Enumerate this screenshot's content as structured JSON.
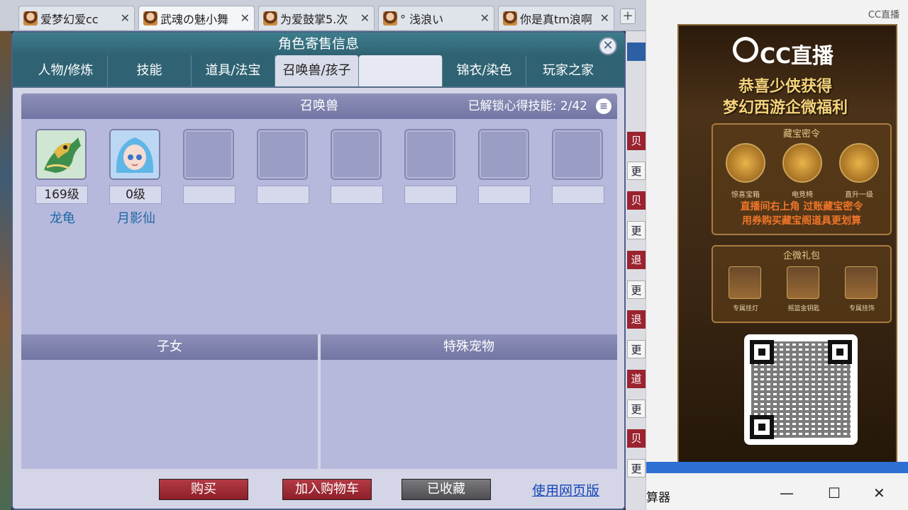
{
  "browser": {
    "tabs": [
      {
        "title": "爱梦幻爱cc",
        "active": false
      },
      {
        "title": "武魂の魅小舞",
        "active": true
      },
      {
        "title": "为爱鼓掌5.次",
        "active": false
      },
      {
        "title": "°  浅浪い",
        "active": false
      },
      {
        "title": "你是真tm浪啊",
        "active": false
      }
    ],
    "new_tab_label": "+",
    "close_glyph": "✕"
  },
  "panel": {
    "title": "角色寄售信息",
    "close_glyph": "✕",
    "tabs": [
      "人物/修炼",
      "技能",
      "道具/法宝",
      "召唤兽/孩子",
      "",
      "锦衣/染色",
      "玩家之家"
    ],
    "active_tab_index": 3
  },
  "pets_section": {
    "title": "召唤兽",
    "skill_label": "已解锁心得技能:",
    "skill_value": "2/42",
    "pets": [
      {
        "level": "169级",
        "name": "龙龟"
      },
      {
        "level": "0级",
        "name": "月影仙"
      }
    ],
    "empty_slots": 6
  },
  "children_section": {
    "title": "子女"
  },
  "special_pets_section": {
    "title": "特殊宠物"
  },
  "actions": {
    "buy": "购买",
    "add_cart": "加入购物车",
    "favorited": "已收藏",
    "web_version": "使用网页版"
  },
  "game_side": {
    "buttons": [
      "贝",
      "更",
      "贝",
      "更",
      "退",
      "更",
      "退",
      "更",
      "道",
      "更",
      "贝",
      "更"
    ]
  },
  "side_window": {
    "brand": "CC直播",
    "brand_top": "CC直播",
    "headline_line1": "恭喜少侠获得",
    "headline_line2": "梦幻西游企微福利",
    "box1_title": "藏宝密令",
    "box1_items": [
      "惊喜宝箱",
      "电竞椅",
      "直升一级"
    ],
    "box1_text_line1": "直播间右上角 过账藏宝密令",
    "box1_text_line2": "用券购买藏宝阁道具更划算",
    "box2_title": "企微礼包",
    "box2_items": [
      "专属挂灯",
      "摇篮金钥匙",
      "专属挂饰"
    ],
    "window_title": "算器",
    "minimize": "—",
    "maximize": "☐",
    "close": "✕"
  },
  "colors": {
    "panel_header": "#2f6373",
    "section_header": "#7d80ad",
    "section_body": "#b7b9dc",
    "buy_button": "#a02e39",
    "favorited_button": "#5f5f63",
    "link": "#1546b8",
    "pet_name": "#1f67a5"
  }
}
